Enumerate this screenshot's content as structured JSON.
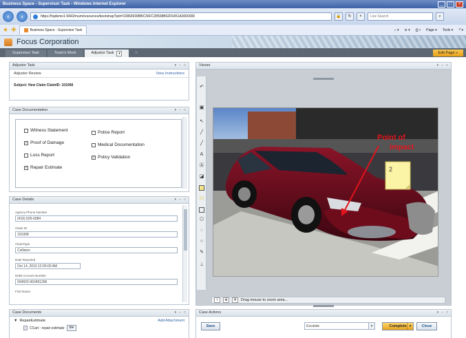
{
  "browser": {
    "title": "Business Space - Supervisor Task - Windows Internet Explorer",
    "address": "https://hqdemo1:9443/mum/resources/bootstrap?pid=C0860930BBC36FC28508B62F6451A3000000",
    "live_search_placeholder": "Live Search",
    "tab_title": "Business Space - Supervisor Task",
    "commands": {
      "page": "Page",
      "tools": "Tools"
    }
  },
  "app": {
    "title": "Focus Corporation",
    "page_tabs": [
      "Supervisor Task",
      "Team's Work",
      "Adjustor Task"
    ],
    "active_tab_index": 2,
    "edit_page_label": "Edit Page"
  },
  "adjustor_task": {
    "header": "Adjustor Task",
    "subheader": "Adjustor Review",
    "instructions_link": "View Instructions",
    "subject": "Subject: New Claim ClaimID: 101068"
  },
  "case_documentation": {
    "header": "Case Documentation",
    "items": [
      {
        "label": "Witness Statement",
        "checked": false
      },
      {
        "label": "Proof of Damage",
        "checked": true
      },
      {
        "label": "Loss Report",
        "checked": false
      },
      {
        "label": "Repair Estimate",
        "checked": true
      },
      {
        "label": "Police Report",
        "checked": false
      },
      {
        "label": "Medical Documentation",
        "checked": false
      },
      {
        "label": "Policy Validation",
        "checked": true
      }
    ]
  },
  "case_details": {
    "header": "Case Details",
    "fields": [
      {
        "label": "Agency Phone Number",
        "value": "(416) 626-6084"
      },
      {
        "label": "Claim ID",
        "value": "101068"
      },
      {
        "label": "ClaimType",
        "value": "Collision"
      },
      {
        "label": "Date Reported",
        "value": "Oct 14, 2010 12:00:00 AM"
      },
      {
        "label": "Debit Account Number",
        "value": "934603-963491396"
      },
      {
        "label": "First Name",
        "value": ""
      }
    ]
  },
  "case_documents": {
    "header": "Case Documents",
    "section": "RepairEstimate",
    "add_link": "Add Attachment",
    "file": "CCart - repair estimate"
  },
  "viewer": {
    "header": "Viewer",
    "annotation_text": "Point of\nImpact",
    "sticky_note": "2",
    "status_text": "Drag mouse to zoom area..."
  },
  "case_actions": {
    "header": "Case Actions",
    "save_label": "Save",
    "escalate_value": "Escalate",
    "complete_label": "Complete",
    "close_label": "Close"
  },
  "colors": {
    "accent": "#e8a21e",
    "annotation_red": "#e0141b"
  }
}
